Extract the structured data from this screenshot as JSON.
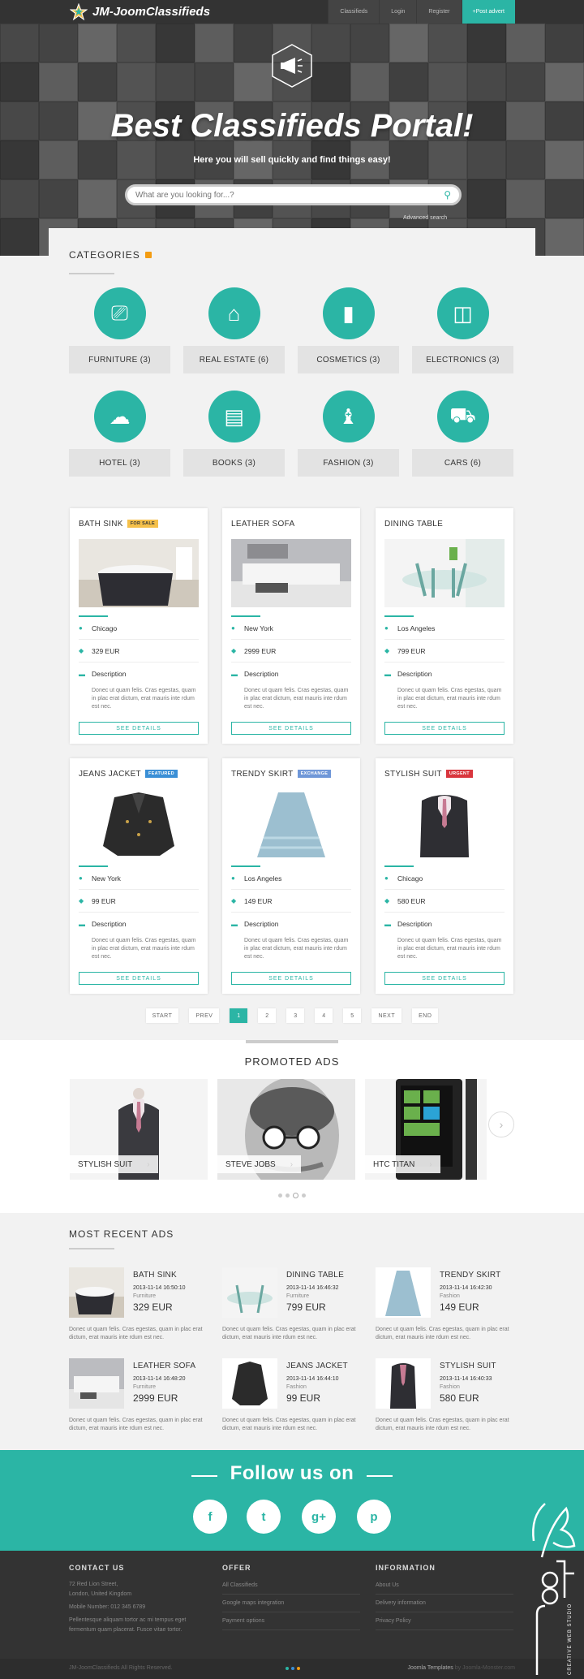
{
  "brand": {
    "name": "JM-JoomClassifieds"
  },
  "nav": {
    "items": [
      "Classifieds",
      "Login",
      "Register"
    ],
    "post": "+Post advert"
  },
  "hero": {
    "title": "Best Classifieds Portal!",
    "subtitle": "Here you will sell quickly and find things easy!",
    "search_placeholder": "What are you looking for...?",
    "advanced": "Advanced search"
  },
  "categories": {
    "title": "CATEGORIES",
    "items": [
      {
        "label": "FURNITURE (3)",
        "icon": "sofa-lamp-icon"
      },
      {
        "label": "REAL ESTATE (6)",
        "icon": "house-icon"
      },
      {
        "label": "COSMETICS (3)",
        "icon": "lipstick-icon"
      },
      {
        "label": "ELECTRONICS (3)",
        "icon": "devices-icon"
      },
      {
        "label": "HOTEL (3)",
        "icon": "service-bell-icon"
      },
      {
        "label": "BOOKS (3)",
        "icon": "book-icon"
      },
      {
        "label": "FASHION (3)",
        "icon": "tshirt-icon"
      },
      {
        "label": "CARS (6)",
        "icon": "car-icon"
      }
    ]
  },
  "ads": [
    {
      "title": "BATH SINK",
      "badge": "FOR SALE",
      "badge_color": "#f5c04a",
      "location": "Chicago",
      "price": "329 EUR",
      "desc_label": "Description",
      "desc": "Donec ut quam felis. Cras egestas, quam in plac erat dictum, erat mauris inte rdum est nec.",
      "button": "SEE DETAILS"
    },
    {
      "title": "LEATHER SOFA",
      "badge": "",
      "badge_color": "",
      "location": "New York",
      "price": "2999 EUR",
      "desc_label": "Description",
      "desc": "Donec ut quam felis. Cras egestas, quam in plac erat dictum, erat mauris inte rdum est nec.",
      "button": "SEE DETAILS"
    },
    {
      "title": "DINING TABLE",
      "badge": "",
      "badge_color": "",
      "location": "Los Angeles",
      "price": "799 EUR",
      "desc_label": "Description",
      "desc": "Donec ut quam felis. Cras egestas, quam in plac erat dictum, erat mauris inte rdum est nec.",
      "button": "SEE DETAILS"
    },
    {
      "title": "JEANS JACKET",
      "badge": "FEATURED",
      "badge_color": "#3a8fd6",
      "location": "New York",
      "price": "99 EUR",
      "desc_label": "Description",
      "desc": "Donec ut quam felis. Cras egestas, quam in plac erat dictum, erat mauris inte rdum est nec.",
      "button": "SEE DETAILS"
    },
    {
      "title": "TRENDY SKIRT",
      "badge": "EXCHANGE",
      "badge_color": "#6f97d8",
      "location": "Los Angeles",
      "price": "149 EUR",
      "desc_label": "Description",
      "desc": "Donec ut quam felis. Cras egestas, quam in plac erat dictum, erat mauris inte rdum est nec.",
      "button": "SEE DETAILS"
    },
    {
      "title": "STYLISH SUIT",
      "badge": "URGENT",
      "badge_color": "#d9363e",
      "location": "Chicago",
      "price": "580 EUR",
      "desc_label": "Description",
      "desc": "Donec ut quam felis. Cras egestas, quam in plac erat dictum, erat mauris inte rdum est nec.",
      "button": "SEE DETAILS"
    }
  ],
  "pagination": [
    "START",
    "PREV",
    "1",
    "2",
    "3",
    "4",
    "5",
    "NEXT",
    "END"
  ],
  "promoted": {
    "title": "PROMOTED ADS",
    "items": [
      "STYLISH SUIT",
      "STEVE JOBS",
      "HTC TITAN"
    ]
  },
  "recent": {
    "title": "MOST RECENT ADS",
    "items": [
      {
        "title": "BATH SINK",
        "date": "2013-11-14 16:50:10",
        "category": "Furniture",
        "price": "329 EUR",
        "desc": "Donec ut quam felis. Cras egestas, quam in plac erat dictum, erat mauris inte rdum est nec."
      },
      {
        "title": "DINING TABLE",
        "date": "2013-11-14 16:46:32",
        "category": "Furniture",
        "price": "799 EUR",
        "desc": "Donec ut quam felis. Cras egestas, quam in plac erat dictum, erat mauris inte rdum est nec."
      },
      {
        "title": "TRENDY SKIRT",
        "date": "2013-11-14 16:42:30",
        "category": "Fashion",
        "price": "149 EUR",
        "desc": "Donec ut quam felis. Cras egestas, quam in plac erat dictum, erat mauris inte rdum est nec."
      },
      {
        "title": "LEATHER SOFA",
        "date": "2013-11-14 16:48:20",
        "category": "Furniture",
        "price": "2999 EUR",
        "desc": "Donec ut quam felis. Cras egestas, quam in plac erat dictum, erat mauris inte rdum est nec."
      },
      {
        "title": "JEANS JACKET",
        "date": "2013-11-14 16:44:10",
        "category": "Fashion",
        "price": "99 EUR",
        "desc": "Donec ut quam felis. Cras egestas, quam in plac erat dictum, erat mauris inte rdum est nec."
      },
      {
        "title": "STYLISH SUIT",
        "date": "2013-11-14 16:40:33",
        "category": "Fashion",
        "price": "580 EUR",
        "desc": "Donec ut quam felis. Cras egestas, quam in plac erat dictum, erat mauris inte rdum est nec."
      }
    ]
  },
  "follow": {
    "title": "Follow us on",
    "icons": [
      "facebook-icon",
      "twitter-icon",
      "google-plus-icon",
      "pinterest-icon"
    ],
    "glyphs": [
      "f",
      "t",
      "g+",
      "p"
    ]
  },
  "footer": {
    "contact": {
      "title": "CONTACT US",
      "address1": "72 Red Lion Street,",
      "address2": "London, United Kingdom",
      "phone": "Mobile Number: 012 345 6789",
      "text1": "Pellentesque aliquam tortor ac mi tempus eget",
      "text2": "fermentum quam placerat. Fusce vitae tortor."
    },
    "offer": {
      "title": "OFFER",
      "links": [
        "All Classifieds",
        "Google maps integration",
        "Payment options"
      ]
    },
    "info": {
      "title": "INFORMATION",
      "links": [
        "About Us",
        "Delivery information",
        "Privacy Policy"
      ]
    },
    "copyright": "JM-JoomClassifieds All Rights Reserved.",
    "credit": "Joomla Templates",
    "credit_by": "by Joomla-Monster.com"
  },
  "colors": {
    "accent": "#2bb5a5",
    "dark": "#333333"
  }
}
